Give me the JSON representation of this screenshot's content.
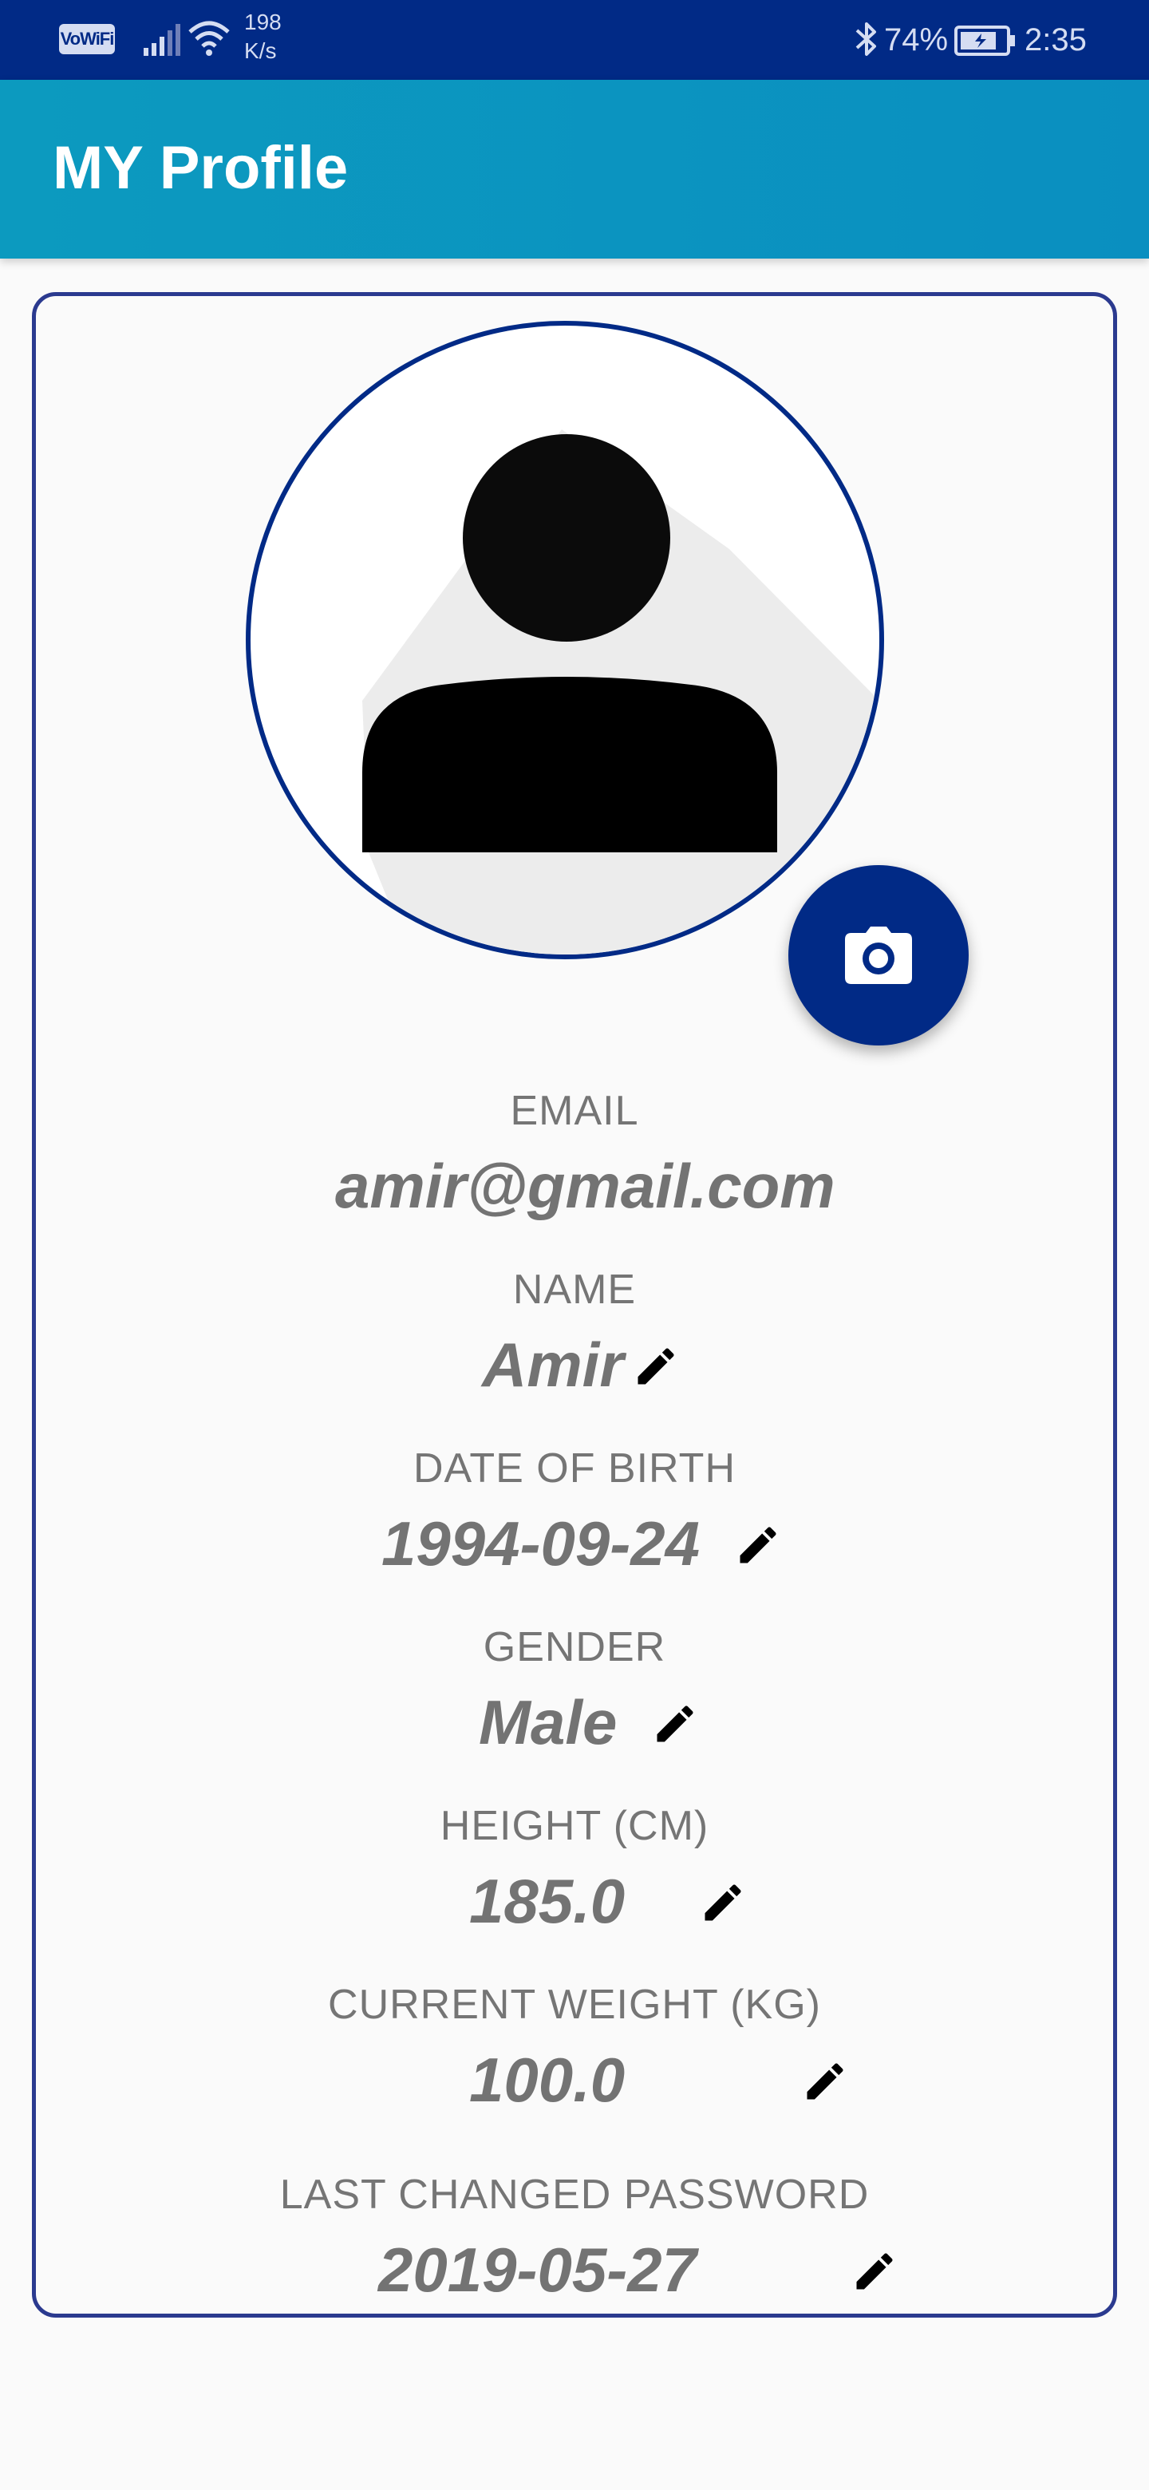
{
  "status_bar": {
    "wifi_badge": "VoWiFi",
    "speed_value": "198",
    "speed_unit": "K/s",
    "battery_percent": "74%",
    "time": "2:35",
    "icons": [
      "signal-icon",
      "wifi-icon",
      "bluetooth-icon",
      "battery-icon"
    ]
  },
  "app_bar": {
    "title": "MY Profile"
  },
  "profile": {
    "avatar_icon": "person-icon",
    "camera_icon": "camera-icon",
    "fields": [
      {
        "label": "EMAIL",
        "value": "amir@gmail.com",
        "editable": false
      },
      {
        "label": "NAME",
        "value": "Amir",
        "editable": true
      },
      {
        "label": "DATE OF BIRTH",
        "value": "1994-09-24",
        "editable": true
      },
      {
        "label": "GENDER",
        "value": "Male",
        "editable": true
      },
      {
        "label": "HEIGHT (CM)",
        "value": "185.0",
        "editable": true
      },
      {
        "label": "CURRENT WEIGHT (KG)",
        "value": "100.0",
        "editable": true
      },
      {
        "label": "LAST CHANGED PASSWORD",
        "value": "2019-05-27",
        "editable": true
      }
    ],
    "edit_icon": "pencil-icon"
  },
  "colors": {
    "status_bar_bg": "#012a86",
    "app_bar_bg": "#0c9abf",
    "card_border": "#2b3a8f",
    "accent": "#012a86",
    "label_text": "#757575",
    "value_text": "#737373"
  }
}
